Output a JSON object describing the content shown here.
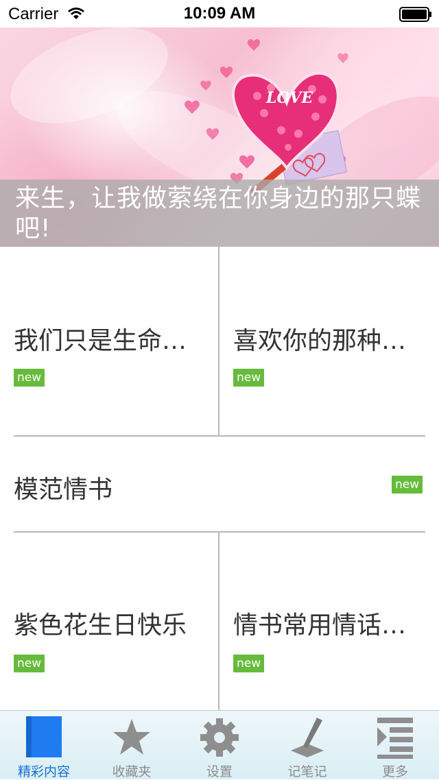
{
  "status_bar": {
    "carrier": "Carrier",
    "time": "10:09 AM"
  },
  "banner": {
    "caption": "来生，让我做萦绕在你身边的那只蝶吧!",
    "image_text": "LOVE"
  },
  "grid": {
    "cells": [
      {
        "title": "我们只是生命…",
        "badge": "new"
      },
      {
        "title": "喜欢你的那种…",
        "badge": "new"
      },
      {
        "title": "模范情书",
        "badge": "new"
      },
      {
        "title": "紫色花生日快乐",
        "badge": "new"
      },
      {
        "title": "情书常用情话…",
        "badge": "new"
      }
    ]
  },
  "tab_bar": {
    "tabs": [
      {
        "label": "精彩内容",
        "icon": "book-icon",
        "active": true
      },
      {
        "label": "收藏夹",
        "icon": "star-icon",
        "active": false
      },
      {
        "label": "设置",
        "icon": "gear-icon",
        "active": false
      },
      {
        "label": "记笔记",
        "icon": "pen-icon",
        "active": false
      },
      {
        "label": "更多",
        "icon": "more-list-icon",
        "active": false
      }
    ]
  },
  "colors": {
    "badge_green": "#66bb3c",
    "active_tab": "#1a6fd4",
    "inactive_tab": "#8c8c8c",
    "caption_overlay": "#aaaaaa"
  }
}
